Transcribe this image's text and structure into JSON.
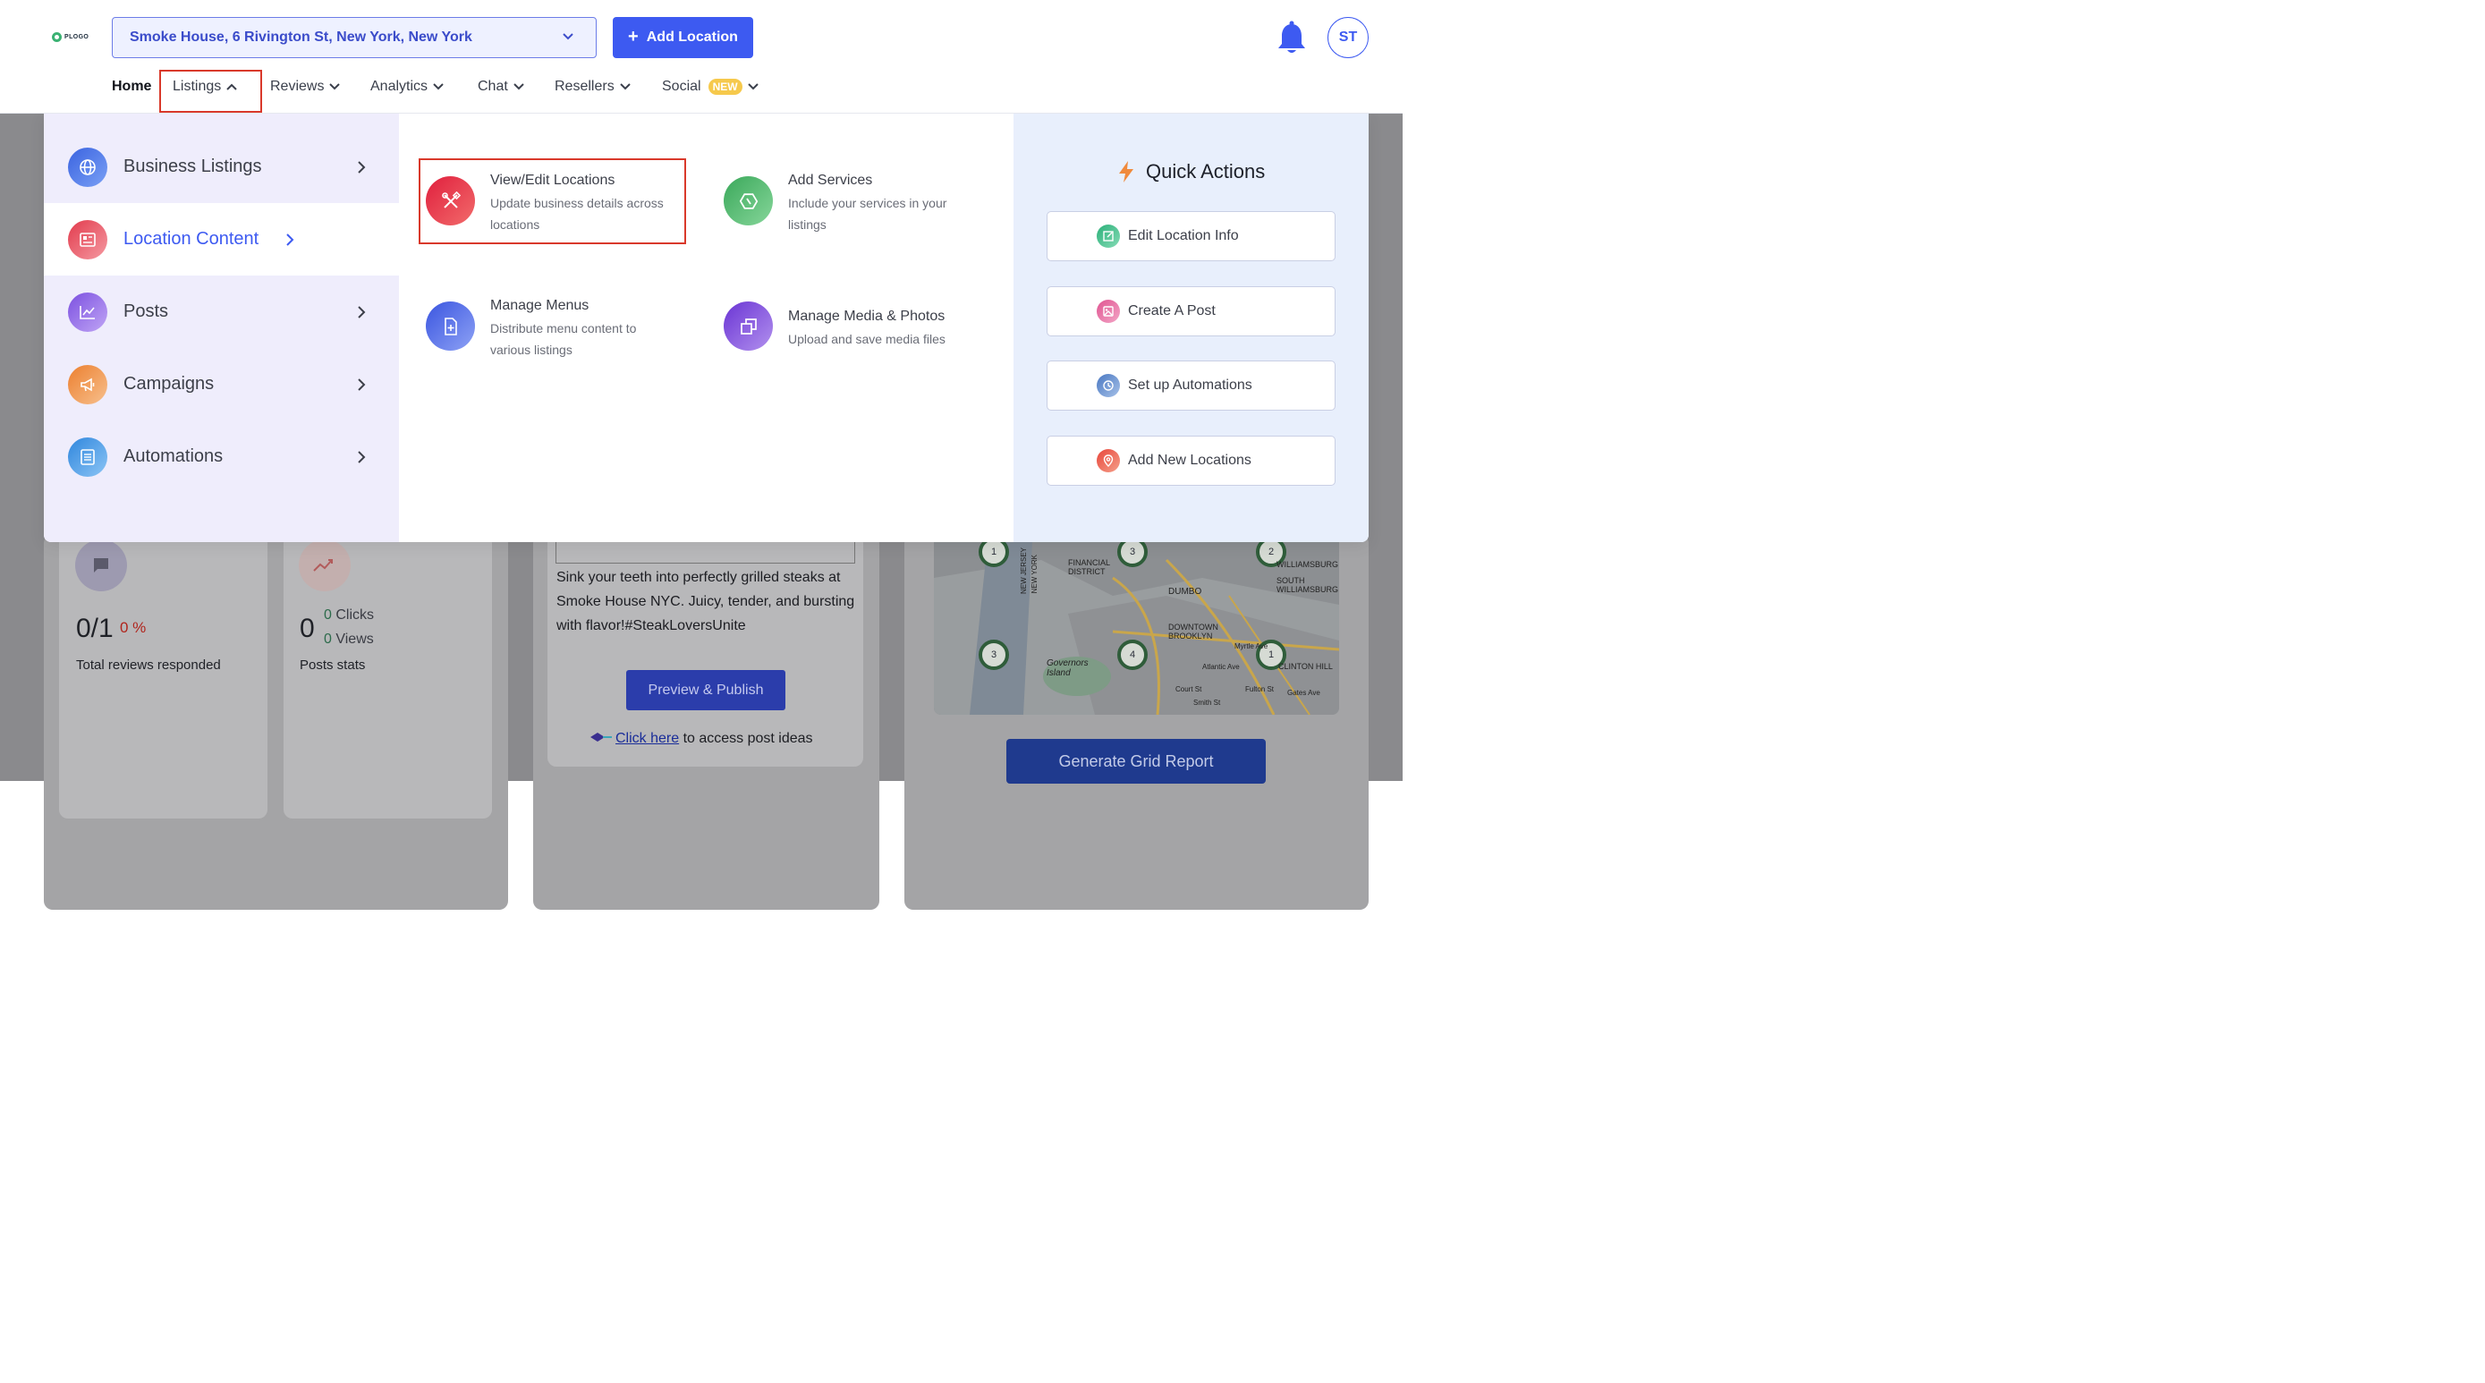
{
  "header": {
    "logo_text": "PLOGO",
    "location_select_value": "Smoke House, 6 Rivington St, New York, New York",
    "add_location_label": "Add Location",
    "avatar_initials": "ST"
  },
  "nav": {
    "items": [
      {
        "label": "Home",
        "has_chevron": false
      },
      {
        "label": "Listings",
        "has_chevron": true,
        "expanded": true
      },
      {
        "label": "Reviews",
        "has_chevron": true
      },
      {
        "label": "Analytics",
        "has_chevron": true
      },
      {
        "label": "Chat",
        "has_chevron": true
      },
      {
        "label": "Resellers",
        "has_chevron": true
      },
      {
        "label": "Social",
        "has_chevron": true,
        "badge": "NEW"
      }
    ]
  },
  "mega_menu": {
    "categories": [
      {
        "label": "Business Listings",
        "icon": "globe-icon",
        "color": "#4a74e8"
      },
      {
        "label": "Location Content",
        "icon": "newspaper-icon",
        "color": "#e8505f",
        "active": true
      },
      {
        "label": "Posts",
        "icon": "chart-line-icon",
        "color": "#8a63e6"
      },
      {
        "label": "Campaigns",
        "icon": "megaphone-icon",
        "color": "#f0934a"
      },
      {
        "label": "Automations",
        "icon": "document-icon",
        "color": "#3f9be3"
      }
    ],
    "items": [
      {
        "title": "View/Edit Locations",
        "desc_line1": "Update business details across",
        "desc_line2": "locations",
        "icon": "tools-icon",
        "color": "#e23a4c"
      },
      {
        "title": "Add Services",
        "desc_line1": "Include your services in your",
        "desc_line2": "listings",
        "icon": "hexagon-icon",
        "color": "#4ab46a"
      },
      {
        "title": "Manage Menus",
        "desc_line1": "Distribute menu content to",
        "desc_line2": "various listings",
        "icon": "file-plus-icon",
        "color": "#4a66e8"
      },
      {
        "title": "Manage Media & Photos",
        "desc_line1": "Upload and save media files",
        "desc_line2": "",
        "icon": "copy-icon",
        "color": "#7b47db"
      }
    ],
    "quick_actions": {
      "title": "Quick Actions",
      "buttons": [
        {
          "label": "Edit Location Info",
          "icon": "edit-icon",
          "color": "#3cb88a"
        },
        {
          "label": "Create A Post",
          "icon": "image-icon",
          "color": "#e56a9a"
        },
        {
          "label": "Set up Automations",
          "icon": "clock-icon",
          "color": "#5a86c7"
        },
        {
          "label": "Add New Locations",
          "icon": "map-pin-icon",
          "color": "#ea6155"
        }
      ]
    }
  },
  "background": {
    "reviews_stat": {
      "value": "0/1",
      "percent": "0 %",
      "label": "Total reviews responded"
    },
    "posts_stat": {
      "value": "0",
      "clicks": "0",
      "clicks_label": "Clicks",
      "views": "0",
      "views_label": "Views",
      "label": "Posts stats"
    },
    "post_text": "Sink your teeth into perfectly grilled steaks at Smoke House NYC. Juicy, tender, and bursting with flavor!#SteakLoversUnite",
    "preview_button": "Preview & Publish",
    "link_text": "Click here",
    "link_suffix": " to access post ideas",
    "grid_report_button": "Generate Grid Report",
    "map_labels": [
      "FINANCIAL DISTRICT",
      "DUMBO",
      "WILLIAMSBURG",
      "SOUTH WILLIAMSBURG",
      "DOWNTOWN BROOKLYN",
      "Governors Island",
      "Myrtle Ave",
      "Atlantic Ave",
      "Fulton St",
      "Gates Ave",
      "Court St",
      "Smith St",
      "CLINTON HILL",
      "NEW JERSEY",
      "NEW YORK"
    ],
    "map_pins": [
      "1",
      "3",
      "2",
      "3",
      "4",
      "1"
    ]
  },
  "colors": {
    "accent": "#3d5af1",
    "highlight_red": "#d9392b"
  }
}
